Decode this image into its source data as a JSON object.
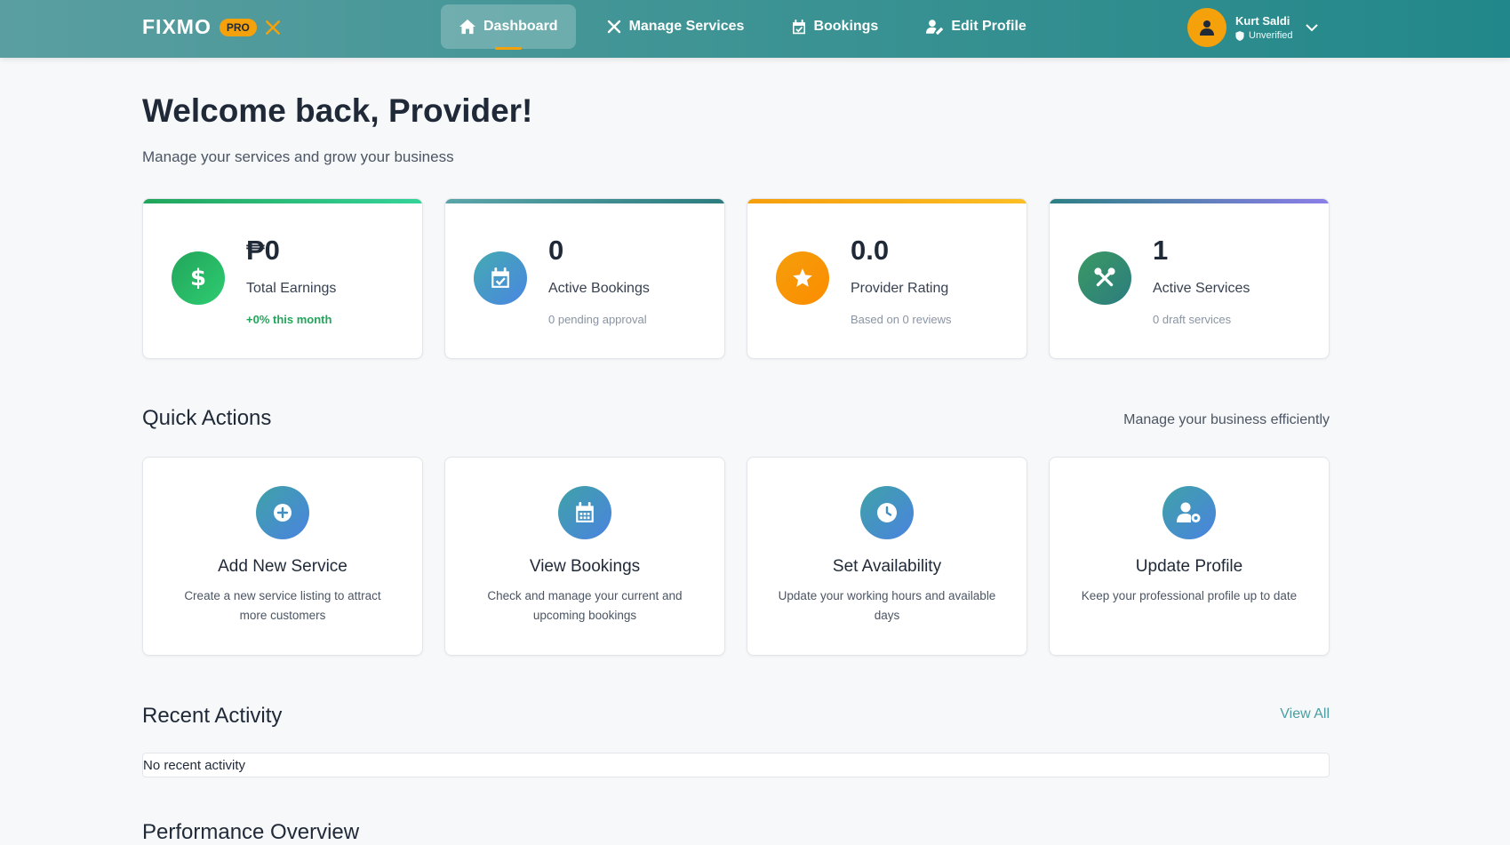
{
  "header": {
    "brand": "FIXMO",
    "badge": "PRO",
    "nav": [
      {
        "label": "Dashboard",
        "icon": "home-icon",
        "active": true
      },
      {
        "label": "Manage Services",
        "icon": "tools-icon",
        "active": false
      },
      {
        "label": "Bookings",
        "icon": "calendar-check-icon",
        "active": false
      },
      {
        "label": "Edit Profile",
        "icon": "user-edit-icon",
        "active": false
      }
    ],
    "user": {
      "name": "Kurt Saldi",
      "status": "Unverified"
    }
  },
  "welcome": {
    "title": "Welcome back, Provider!",
    "subtitle": "Manage your services and grow your business"
  },
  "stats": [
    {
      "value": "₱0",
      "label": "Total Earnings",
      "meta": "+0% this month",
      "icon": "dollar-icon",
      "accent": "#22a55b"
    },
    {
      "value": "0",
      "label": "Active Bookings",
      "meta": "0 pending approval",
      "icon": "calendar-check-icon",
      "accent": "#3c8f97"
    },
    {
      "value": "0.0",
      "label": "Provider Rating",
      "meta": "Based on 0 reviews",
      "icon": "star-icon",
      "accent": "#f59e0b"
    },
    {
      "value": "1",
      "label": "Active Services",
      "meta": "0 draft services",
      "icon": "tools-icon",
      "accent": "#8b7ee8"
    }
  ],
  "quick_actions": {
    "title": "Quick Actions",
    "aside": "Manage your business efficiently",
    "items": [
      {
        "title": "Add New Service",
        "desc": "Create a new service listing to attract more customers",
        "icon": "plus-circle-icon"
      },
      {
        "title": "View Bookings",
        "desc": "Check and manage your current and upcoming bookings",
        "icon": "calendar-grid-icon"
      },
      {
        "title": "Set Availability",
        "desc": "Update your working hours and available days",
        "icon": "clock-icon"
      },
      {
        "title": "Update Profile",
        "desc": "Keep your professional profile up to date",
        "icon": "user-cog-icon"
      }
    ]
  },
  "recent_activity": {
    "title": "Recent Activity",
    "view_all": "View All",
    "empty": "No recent activity"
  },
  "performance": {
    "title": "Performance Overview"
  }
}
